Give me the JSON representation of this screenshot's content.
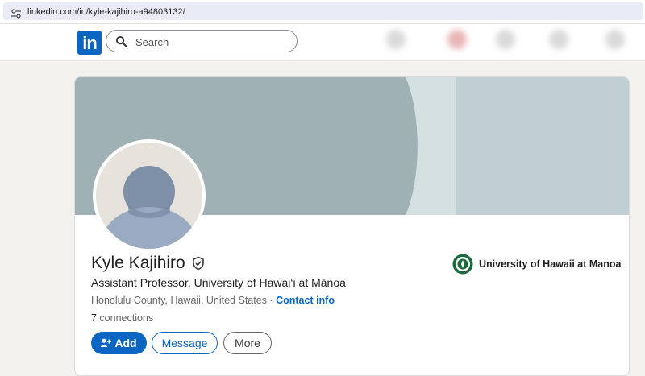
{
  "browser": {
    "url": "linkedin.com/in/kyle-kajihiro-a94803132/"
  },
  "header": {
    "logo_text": "in",
    "search": {
      "placeholder": "Search"
    }
  },
  "profile": {
    "name": "Kyle Kajihiro",
    "headline": "Assistant Professor, University of Hawai‘i at Mānoa",
    "location": "Honolulu County, Hawaii, United States",
    "location_separator": " · ",
    "contact_info_label": "Contact info",
    "connections_count": "7",
    "connections_label": " connections",
    "education": {
      "school_name": "University of Hawaii at Manoa"
    },
    "actions": {
      "add_label": "Add",
      "message_label": "Message",
      "more_label": "More"
    }
  },
  "colors": {
    "brand": "#0a66c2",
    "banner_dark": "#9fb1b5",
    "banner_light": "#d5e1e1",
    "banner_right": "#bfcfd3",
    "page_bg": "#f4f2ee",
    "avatar_bg": "#e6e2dc",
    "avatar_figure": "#7e8fa8",
    "seal": "#1a6b3e"
  },
  "icons": {
    "url_bar": "site-settings-icon",
    "search": "search-icon",
    "verification": "verified-shield-icon",
    "add": "add-person-icon"
  }
}
